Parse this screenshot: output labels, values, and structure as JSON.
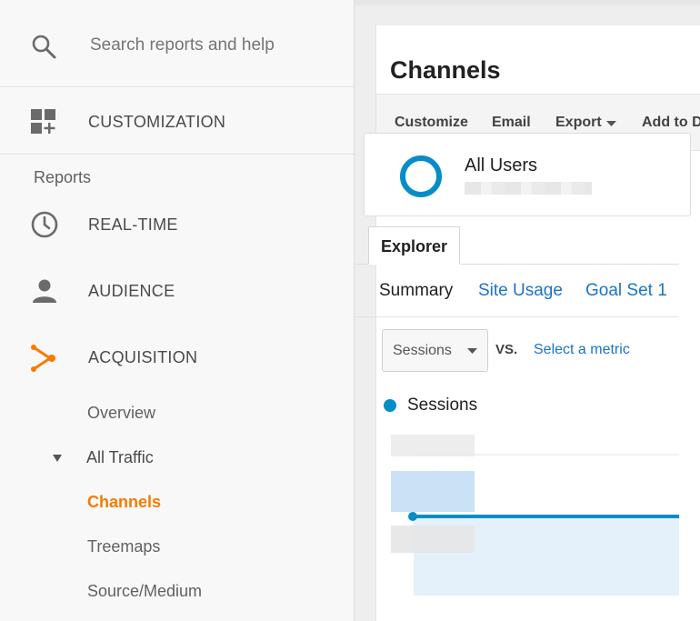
{
  "sidebar": {
    "search": {
      "placeholder": "Search reports and help"
    },
    "customization_label": "CUSTOMIZATION",
    "reports_label": "Reports",
    "nav": {
      "realtime": "REAL-TIME",
      "audience": "AUDIENCE",
      "acquisition": "ACQUISITION"
    },
    "acquisition_items": {
      "overview": "Overview",
      "all_traffic": "All Traffic",
      "channels": "Channels",
      "treemaps": "Treemaps",
      "source_medium": "Source/Medium"
    },
    "accent_color": "#f57c00"
  },
  "main": {
    "title": "Channels",
    "toolbar": {
      "customize": "Customize",
      "email": "Email",
      "export": "Export",
      "add_to": "Add to D"
    },
    "segment": {
      "name": "All Users",
      "ring_color": "#058dc7"
    },
    "explorer_tab": "Explorer",
    "subtabs": {
      "summary": "Summary",
      "site_usage": "Site Usage",
      "goal_set": "Goal Set 1"
    },
    "metric": {
      "selected": "Sessions",
      "vs": "VS.",
      "select_metric": "Select a metric"
    },
    "legend": {
      "label": "Sessions",
      "color": "#058dc7"
    },
    "link_color": "#1a73c8"
  }
}
